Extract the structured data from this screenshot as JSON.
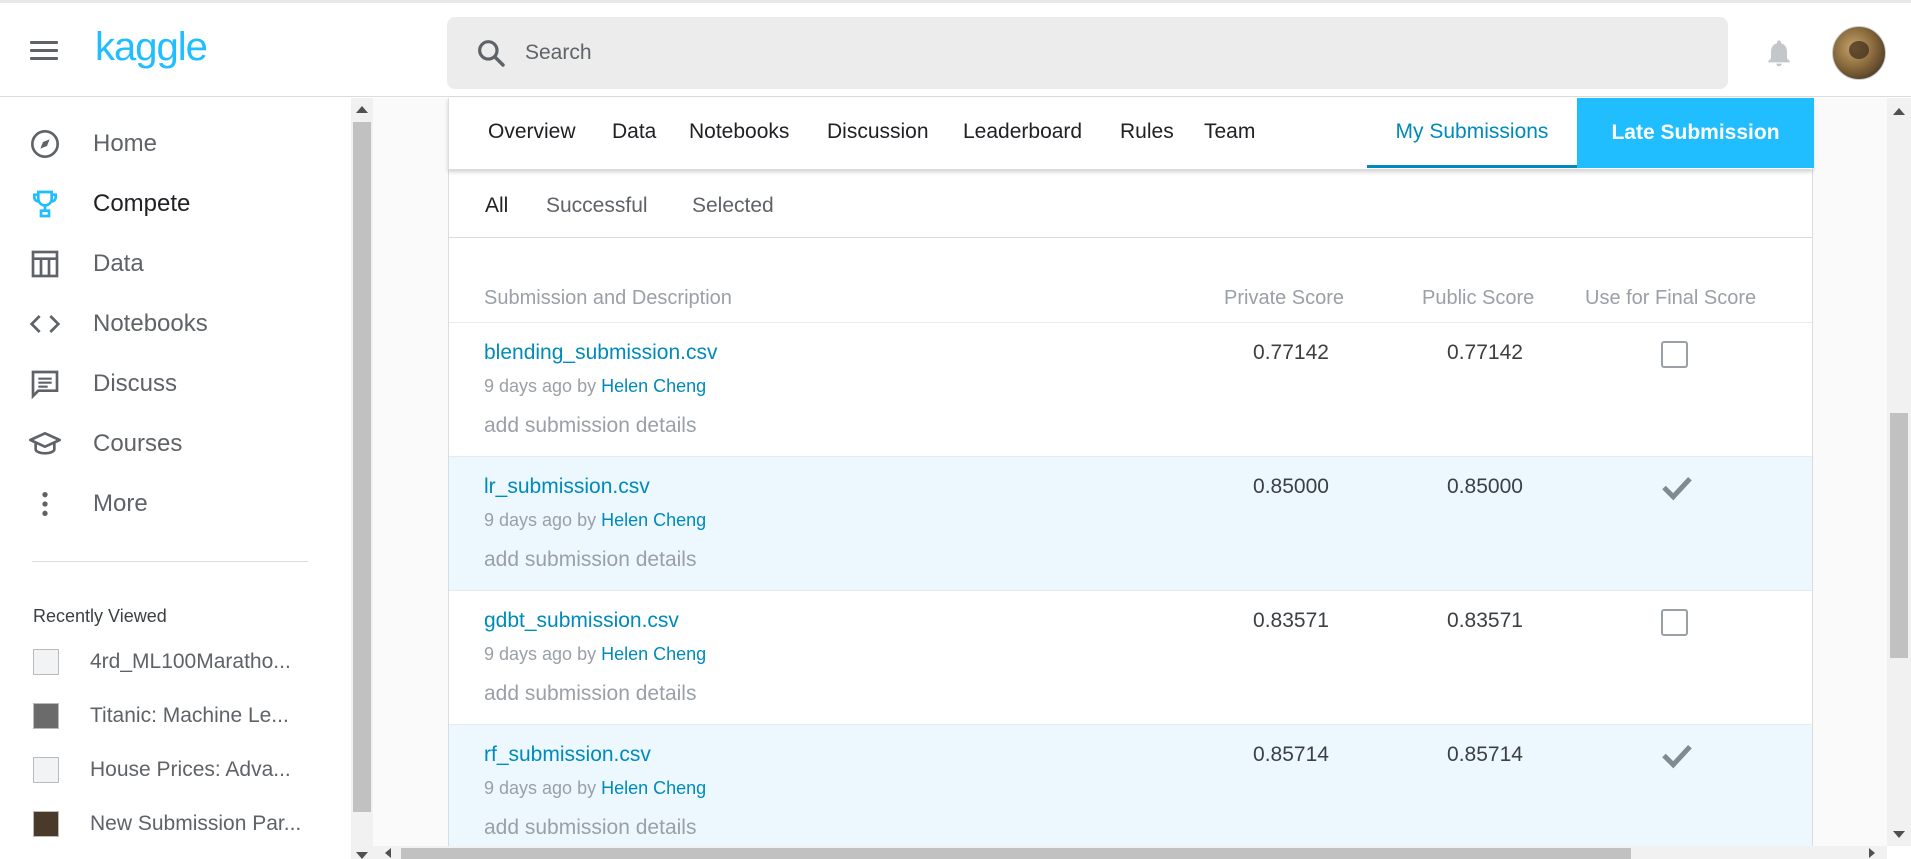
{
  "brand": {
    "logo_text": "kaggle",
    "accent": "#20beff",
    "link_color": "#008abc"
  },
  "search": {
    "placeholder": "Search"
  },
  "icons": {
    "menu": "hamburger-icon",
    "search": "search-icon",
    "notifications": "bell-icon"
  },
  "sidebar": {
    "items": [
      {
        "label": "Home",
        "icon": "compass-icon",
        "active": false
      },
      {
        "label": "Compete",
        "icon": "trophy-icon",
        "active": true
      },
      {
        "label": "Data",
        "icon": "table-icon",
        "active": false
      },
      {
        "label": "Notebooks",
        "icon": "code-icon",
        "active": false
      },
      {
        "label": "Discuss",
        "icon": "comment-icon",
        "active": false
      },
      {
        "label": "Courses",
        "icon": "graduation-cap-icon",
        "active": false
      },
      {
        "label": "More",
        "icon": "more-vertical-icon",
        "active": false
      }
    ],
    "recent_title": "Recently Viewed",
    "recent": [
      {
        "label": "4rd_ML100Maratho..."
      },
      {
        "label": "Titanic: Machine Le..."
      },
      {
        "label": "House Prices: Adva..."
      },
      {
        "label": "New Submission Par..."
      }
    ]
  },
  "tabs": {
    "items": [
      "Overview",
      "Data",
      "Notebooks",
      "Discussion",
      "Leaderboard",
      "Rules",
      "Team"
    ],
    "my_submissions": "My Submissions",
    "late_submission": "Late Submission"
  },
  "subtabs": {
    "all": "All",
    "successful": "Successful",
    "selected": "Selected",
    "active": "All"
  },
  "table": {
    "headers": {
      "description": "Submission and Description",
      "private": "Private Score",
      "public": "Public Score",
      "final": "Use for Final Score"
    },
    "rows": [
      {
        "file": "blending_submission.csv",
        "age": "9 days ago by",
        "author": "Helen Cheng",
        "details": "add submission details",
        "private": "0.77142",
        "public": "0.77142",
        "selected": false
      },
      {
        "file": "lr_submission.csv",
        "age": "9 days ago by",
        "author": "Helen Cheng",
        "details": "add submission details",
        "private": "0.85000",
        "public": "0.85000",
        "selected": true
      },
      {
        "file": "gdbt_submission.csv",
        "age": "9 days ago by",
        "author": "Helen Cheng",
        "details": "add submission details",
        "private": "0.83571",
        "public": "0.83571",
        "selected": false
      },
      {
        "file": "rf_submission.csv",
        "age": "9 days ago by",
        "author": "Helen Cheng",
        "details": "add submission details",
        "private": "0.85714",
        "public": "0.85714",
        "selected": true
      }
    ]
  }
}
